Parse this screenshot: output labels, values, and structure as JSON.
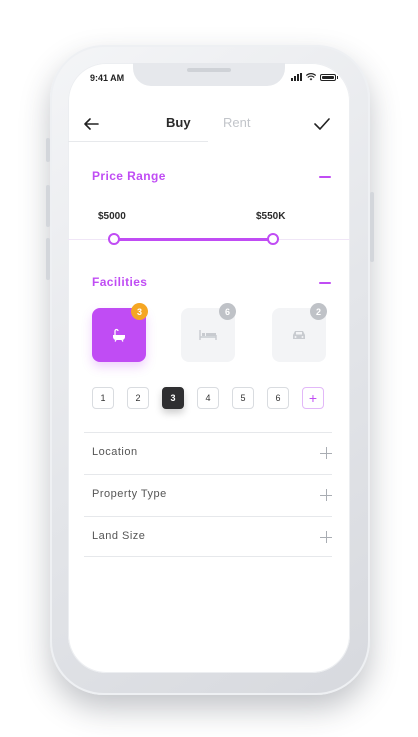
{
  "status_bar": {
    "time": "9:41 AM"
  },
  "header": {
    "tabs": [
      {
        "label": "Buy",
        "active": true
      },
      {
        "label": "Rent",
        "active": false
      }
    ],
    "back_icon": "arrow-left-icon",
    "confirm_icon": "check-icon"
  },
  "price_range": {
    "title": "Price Range",
    "min_label": "$5000",
    "max_label": "$550K"
  },
  "facilities": {
    "title": "Facilities",
    "items": [
      {
        "icon": "bathtub-icon",
        "count": "3",
        "active": true
      },
      {
        "icon": "bed-icon",
        "count": "6",
        "active": false
      },
      {
        "icon": "car-icon",
        "count": "2",
        "active": false
      }
    ],
    "numbers": [
      "1",
      "2",
      "3",
      "4",
      "5",
      "6"
    ],
    "selected_number": "3",
    "add_label": "+"
  },
  "filters": [
    {
      "label": "Location"
    },
    {
      "label": "Property Type"
    },
    {
      "label": "Land Size"
    }
  ],
  "colors": {
    "accent": "#c04cf4",
    "badge_active": "#f5a623",
    "badge_inactive": "#bfc2c7",
    "selected_dark": "#2f2f31"
  }
}
